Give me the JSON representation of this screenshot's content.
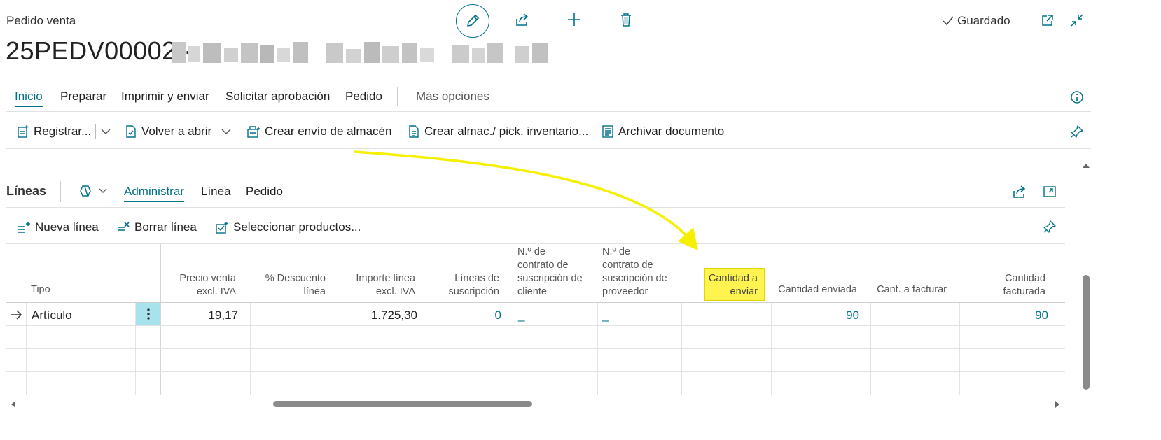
{
  "header": {
    "caption": "Pedido venta",
    "document_no": "25PEDV00002",
    "separator": "·",
    "save_status": "Guardado"
  },
  "tabs": [
    {
      "label": "Inicio"
    },
    {
      "label": "Preparar"
    },
    {
      "label": "Imprimir y enviar"
    },
    {
      "label": "Solicitar aprobación"
    },
    {
      "label": "Pedido"
    },
    {
      "label": "Más opciones"
    }
  ],
  "commands": {
    "registrar": "Registrar...",
    "volver_abrir": "Volver a abrir",
    "crear_envio": "Crear envío de almacén",
    "crear_pick": "Crear almac./ pick. inventario...",
    "archivar": "Archivar documento"
  },
  "lines": {
    "title": "Líneas",
    "tabs": [
      {
        "label": "Administrar"
      },
      {
        "label": "Línea"
      },
      {
        "label": "Pedido"
      }
    ],
    "commands": {
      "nueva": "Nueva línea",
      "borrar": "Borrar línea",
      "seleccionar": "Seleccionar productos..."
    },
    "columns": {
      "tipo": "Tipo",
      "precio": [
        "Precio venta",
        "excl. IVA"
      ],
      "descuento": [
        "% Descuento",
        "línea"
      ],
      "importe": [
        "Importe línea",
        "excl. IVA"
      ],
      "lineas_susc": [
        "Líneas de",
        "suscripción"
      ],
      "contrato_cliente": [
        "N.º de",
        "contrato de",
        "suscripción de",
        "cliente"
      ],
      "contrato_proveedor": [
        "N.º de",
        "contrato de",
        "suscripción de",
        "proveedor"
      ],
      "cantidad_enviar": [
        "Cantidad a",
        "enviar"
      ],
      "cantidad_enviada": "Cantidad enviada",
      "cant_facturar": "Cant. a facturar",
      "cantidad_facturada": [
        "Cantidad",
        "facturada"
      ]
    },
    "rows": [
      {
        "tipo": "Artículo",
        "precio": "19,17",
        "descuento": "",
        "importe": "1.725,30",
        "lineas_susc": "0",
        "contrato_cliente": "_",
        "contrato_proveedor": "_",
        "cantidad_enviar": "",
        "cantidad_enviada": "90",
        "cant_facturar": "",
        "cantidad_facturada": "90"
      }
    ]
  },
  "colors": {
    "accent": "#00718a",
    "highlight": "#fff44f",
    "arrow": "#f5ef00"
  }
}
